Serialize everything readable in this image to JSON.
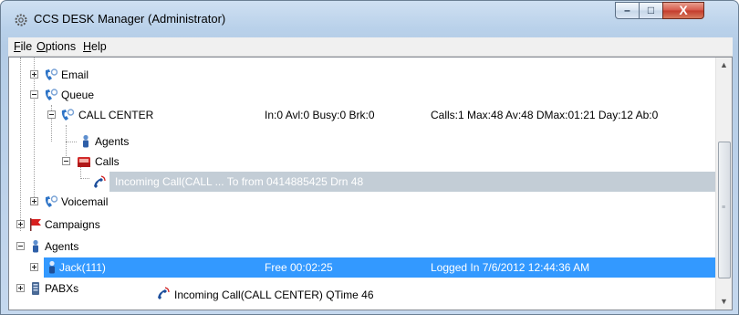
{
  "window": {
    "title": "CCS DESK Manager (Administrator)",
    "controls": {
      "minimize": "–",
      "maximize": "□",
      "close": "X"
    }
  },
  "menu": [
    {
      "label": "File",
      "accel": "F",
      "rest": "ile"
    },
    {
      "label": "Options",
      "accel": "O",
      "rest": "ptions"
    },
    {
      "label": "Help",
      "accel": "H",
      "rest": "elp"
    }
  ],
  "tree": {
    "email": "Email",
    "queue": "Queue",
    "call_center": {
      "label": "CALL CENTER",
      "stats": "In:0  Avl:0  Busy:0  Brk:0",
      "calls_info": "Calls:1  Max:48  Av:48  DMax:01:21  Day:12  Ab:0"
    },
    "agents_sub": "Agents",
    "calls": "Calls",
    "incoming_call": "Incoming Call(CALL ...  To  from 0414885425 Drn 48",
    "voicemail": "Voicemail",
    "campaigns": "Campaigns",
    "agents": "Agents",
    "jack": {
      "label": "Jack(111)",
      "status": "Free 00:02:25",
      "login": "Logged In 7/6/2012 12:44:36 AM"
    },
    "pabxs": "PABXs",
    "queue_call": "Incoming Call(CALL CENTER) QTime 46"
  },
  "icons": {
    "app": "gear-icon",
    "phone": "phone-person-icon",
    "agent": "agent-person-icon",
    "calls_folder": "red-folder-icon",
    "handset": "ringing-handset-icon",
    "campaign": "red-flag-icon",
    "pabx": "server-icon"
  },
  "colors": {
    "selection_blue": "#3399ff",
    "selection_gray": "#c3cdd6",
    "phone_blue": "#2e74c7"
  }
}
